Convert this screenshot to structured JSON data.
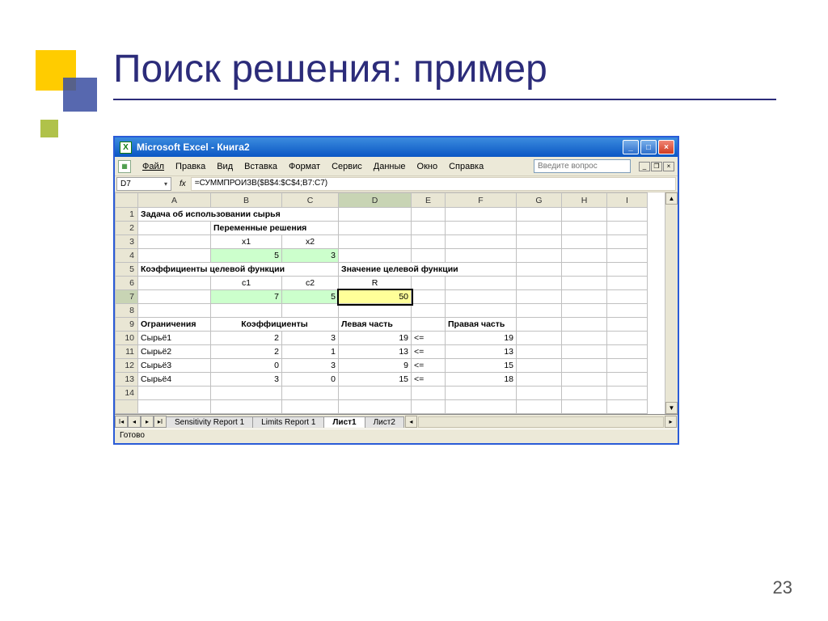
{
  "slide": {
    "title": "Поиск решения: пример",
    "page_number": "23"
  },
  "window": {
    "title": "Microsoft Excel - Книга2"
  },
  "menu": {
    "file": "Файл",
    "edit": "Правка",
    "view": "Вид",
    "insert": "Вставка",
    "format": "Формат",
    "tools": "Сервис",
    "data": "Данные",
    "window": "Окно",
    "help": "Справка",
    "question_placeholder": "Введите вопрос"
  },
  "formula_bar": {
    "name_box": "D7",
    "fx": "fx",
    "formula": "=СУММПРОИЗВ($B$4:$C$4;B7:C7)"
  },
  "columns": [
    "A",
    "B",
    "C",
    "D",
    "E",
    "F",
    "G",
    "H",
    "I"
  ],
  "rows": {
    "r1": {
      "A": "Задача об использовании сырья"
    },
    "r2": {
      "B": "Переменные решения"
    },
    "r3": {
      "B": "x1",
      "C": "x2"
    },
    "r4": {
      "B": "5",
      "C": "3"
    },
    "r5": {
      "A": "Коэффициенты целевой функции",
      "D": "Значение целевой функции"
    },
    "r6": {
      "B": "c1",
      "C": "c2",
      "D": "R"
    },
    "r7": {
      "B": "7",
      "C": "5",
      "D": "50"
    },
    "r9": {
      "A": "Ограничения",
      "B": "Коэффициенты",
      "D": "Левая часть",
      "F": "Правая часть"
    },
    "r10": {
      "A": "Сырьё1",
      "B": "2",
      "C": "3",
      "D": "19",
      "E": "<=",
      "F": "19"
    },
    "r11": {
      "A": "Сырьё2",
      "B": "2",
      "C": "1",
      "D": "13",
      "E": "<=",
      "F": "13"
    },
    "r12": {
      "A": "Сырьё3",
      "B": "0",
      "C": "3",
      "D": "9",
      "E": "<=",
      "F": "15"
    },
    "r13": {
      "A": "Сырьё4",
      "B": "3",
      "C": "0",
      "D": "15",
      "E": "<=",
      "F": "18"
    }
  },
  "tabs": {
    "t1": "Sensitivity Report 1",
    "t2": "Limits Report 1",
    "t3": "Лист1",
    "t4": "Лист2"
  },
  "status": "Готово"
}
